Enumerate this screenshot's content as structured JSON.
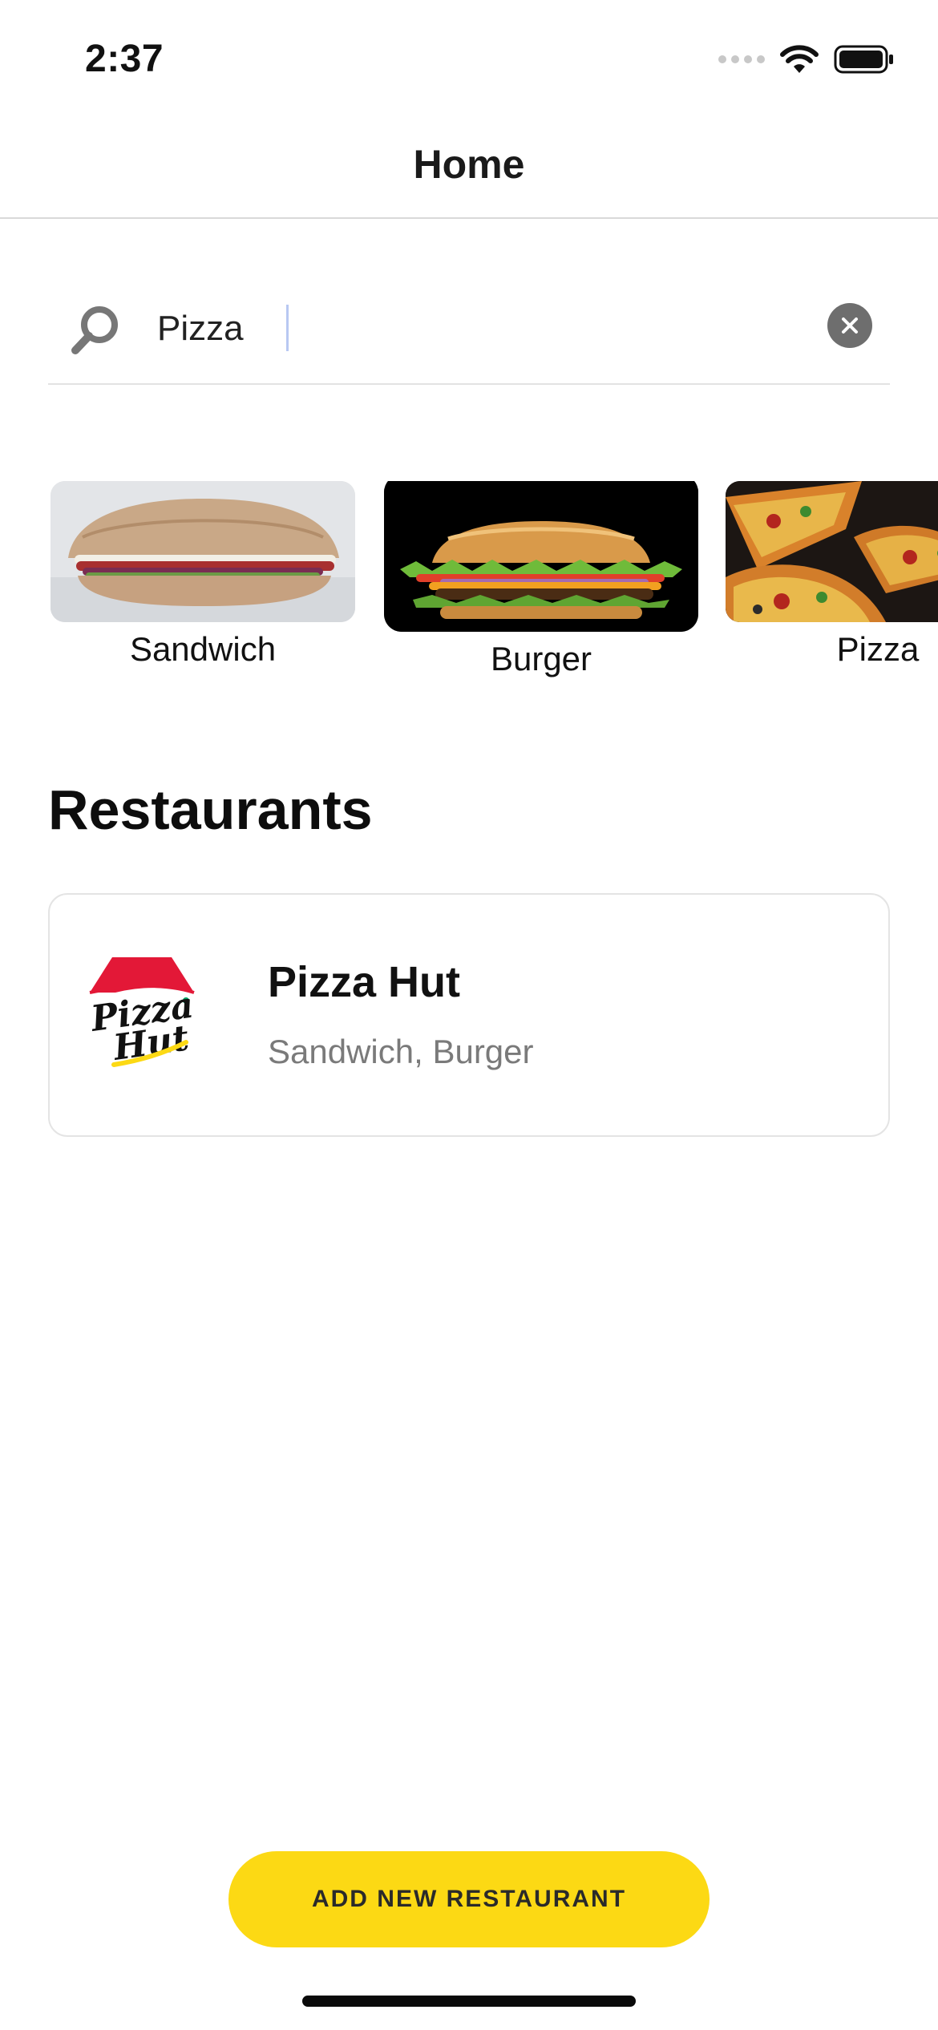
{
  "status_bar": {
    "time": "2:37"
  },
  "nav": {
    "title": "Home"
  },
  "search": {
    "value": "Pizza",
    "icon": "search-icon",
    "clear_icon": "clear-icon"
  },
  "categories": [
    {
      "label": "Sandwich"
    },
    {
      "label": "Burger"
    },
    {
      "label": "Pizza"
    }
  ],
  "restaurants": {
    "section_title": "Restaurants",
    "items": [
      {
        "name": "Pizza Hut",
        "cuisines": "Sandwich, Burger",
        "logo_text_line1": "Pizza",
        "logo_text_line2": "Hut"
      }
    ]
  },
  "actions": {
    "add_restaurant_label": "ADD NEW RESTAURANT"
  },
  "colors": {
    "accent": "#fcd914",
    "secondary_text": "#7a7a7a",
    "logo_red": "#e31837"
  }
}
